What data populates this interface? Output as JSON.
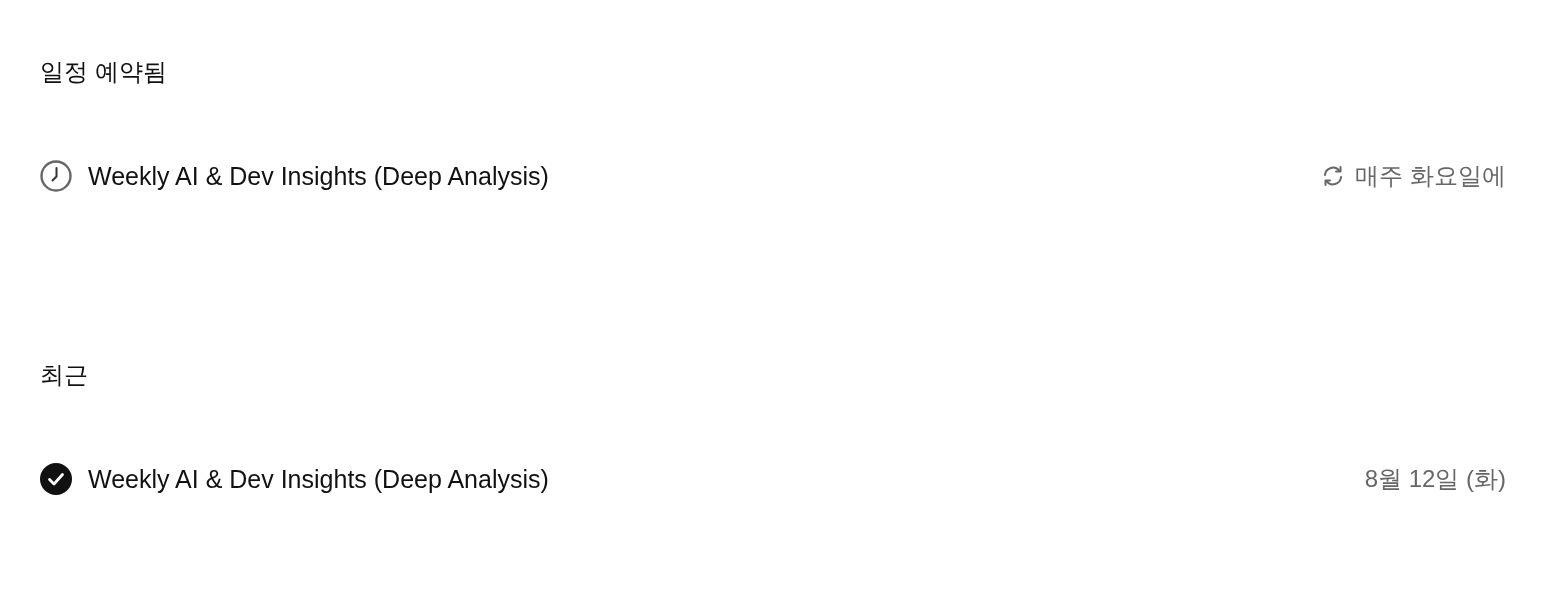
{
  "sections": [
    {
      "heading": "일정 예약됨",
      "tasks": [
        {
          "kind": "scheduled",
          "title": "Weekly AI & Dev Insights (Deep Analysis)",
          "meta": {
            "kind": "repeat",
            "text": "매주 화요일에"
          }
        }
      ]
    },
    {
      "heading": "최근",
      "tasks": [
        {
          "kind": "completed",
          "title": "Weekly AI & Dev Insights (Deep Analysis)",
          "meta": {
            "kind": "date",
            "text": "8월 12일 (화)"
          }
        }
      ]
    }
  ]
}
